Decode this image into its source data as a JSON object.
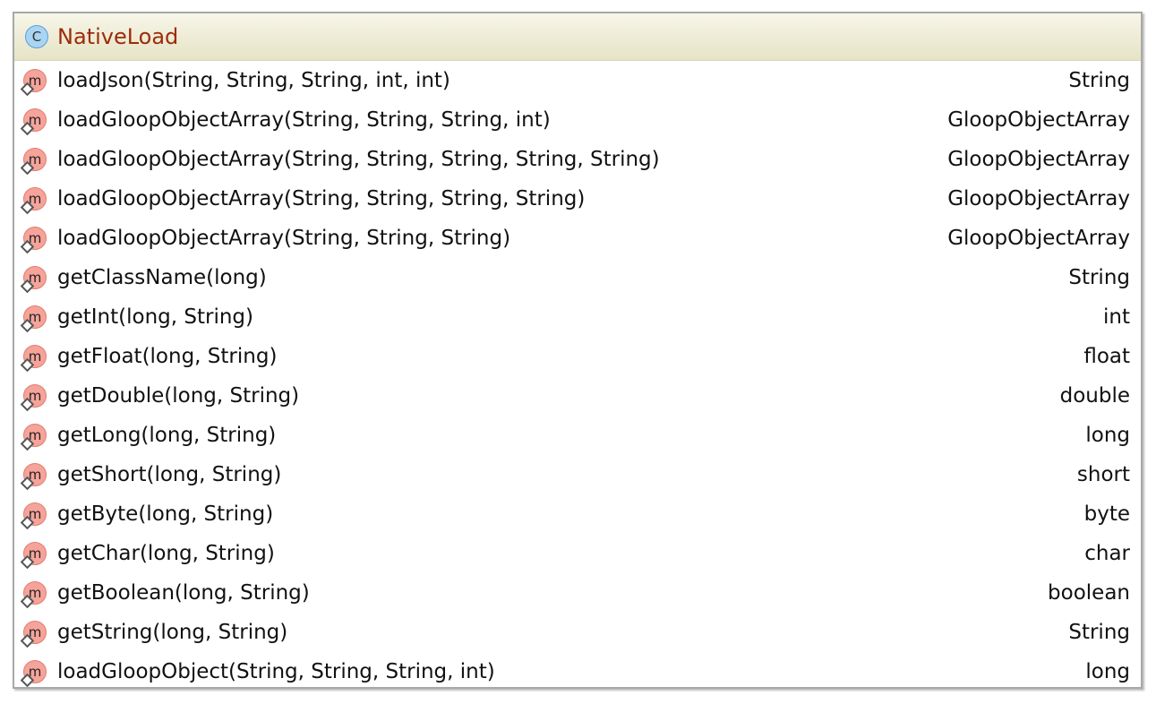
{
  "class": {
    "name": "NativeLoad",
    "icon": "class-icon",
    "icon_letter": "C"
  },
  "method_icon_letter": "m",
  "colors": {
    "title": "#9c2c0a",
    "header_bg": "#ece9cf",
    "method_icon": "#f6a39a",
    "class_icon": "#a9d5f3"
  },
  "methods": [
    {
      "signature": "loadJson(String, String, String, int, int)",
      "return_type": "String"
    },
    {
      "signature": "loadGloopObjectArray(String, String, String, int)",
      "return_type": "GloopObjectArray"
    },
    {
      "signature": "loadGloopObjectArray(String, String, String, String, String)",
      "return_type": "GloopObjectArray"
    },
    {
      "signature": "loadGloopObjectArray(String, String, String, String)",
      "return_type": "GloopObjectArray"
    },
    {
      "signature": "loadGloopObjectArray(String, String, String)",
      "return_type": "GloopObjectArray"
    },
    {
      "signature": "getClassName(long)",
      "return_type": "String"
    },
    {
      "signature": "getInt(long, String)",
      "return_type": "int"
    },
    {
      "signature": "getFloat(long, String)",
      "return_type": "float"
    },
    {
      "signature": "getDouble(long, String)",
      "return_type": "double"
    },
    {
      "signature": "getLong(long, String)",
      "return_type": "long"
    },
    {
      "signature": "getShort(long, String)",
      "return_type": "short"
    },
    {
      "signature": "getByte(long, String)",
      "return_type": "byte"
    },
    {
      "signature": "getChar(long, String)",
      "return_type": "char"
    },
    {
      "signature": "getBoolean(long, String)",
      "return_type": "boolean"
    },
    {
      "signature": "getString(long, String)",
      "return_type": "String"
    },
    {
      "signature": "loadGloopObject(String, String, String, int)",
      "return_type": "long"
    }
  ]
}
